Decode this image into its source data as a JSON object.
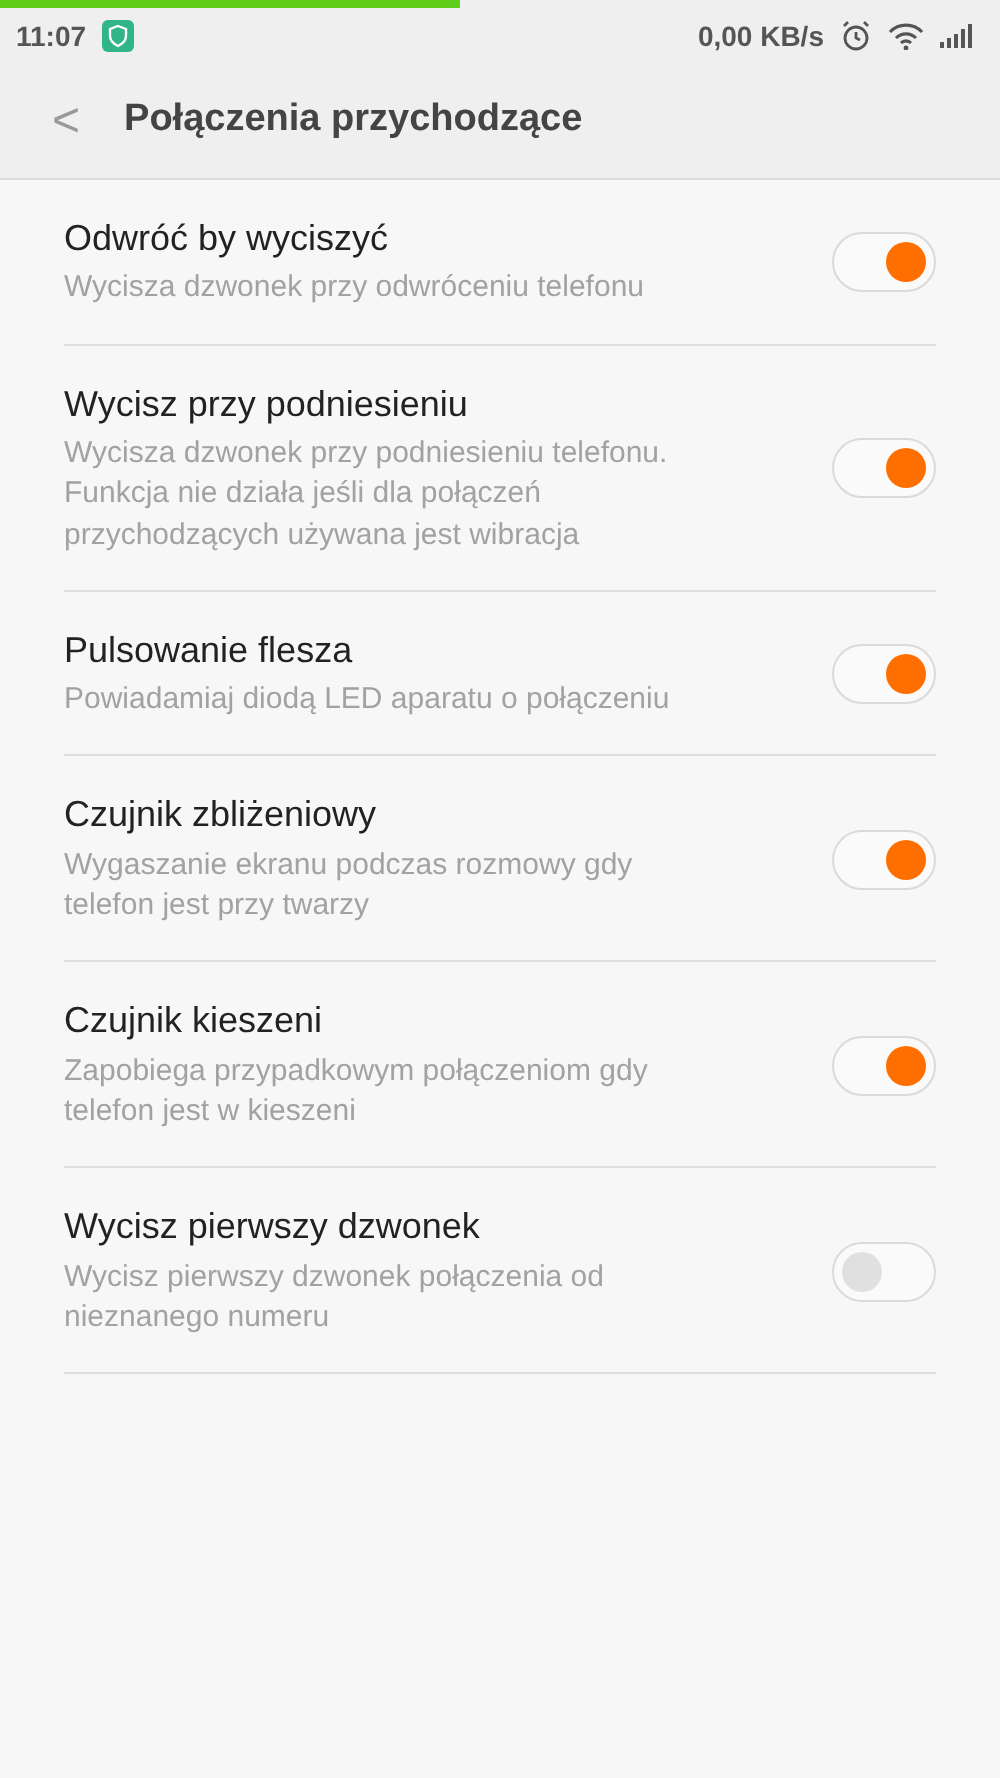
{
  "load_progress": {
    "level": 0.46
  },
  "status_bar": {
    "time": "11:07",
    "speed": "0,00 KB/s"
  },
  "header": {
    "back": "<",
    "title": "Połączenia przychodzące"
  },
  "settings": [
    {
      "title": "Odwróć by wyciszyć",
      "description": "Wycisza dzwonek przy odwróceniu telefonu",
      "on": true
    },
    {
      "title": "Wycisz przy podniesieniu",
      "description": "Wycisza dzwonek przy podniesieniu telefonu. Funkcja nie działa jeśli dla połączeń przychodzących używana jest wibracja",
      "on": true
    },
    {
      "title": "Pulsowanie flesza",
      "description": "Powiadamiaj diodą LED aparatu o połączeniu",
      "on": true
    },
    {
      "title": "Czujnik zbliżeniowy",
      "description": "Wygaszanie ekranu podczas rozmowy gdy telefon jest przy twarzy",
      "on": true
    },
    {
      "title": "Czujnik kieszeni",
      "description": "Zapobiega przypadkowym połączeniom gdy telefon jest w kieszeni",
      "on": true
    },
    {
      "title": "Wycisz pierwszy dzwonek",
      "description": "Wycisz pierwszy dzwonek połączenia od nieznanego numeru",
      "on": false
    }
  ]
}
